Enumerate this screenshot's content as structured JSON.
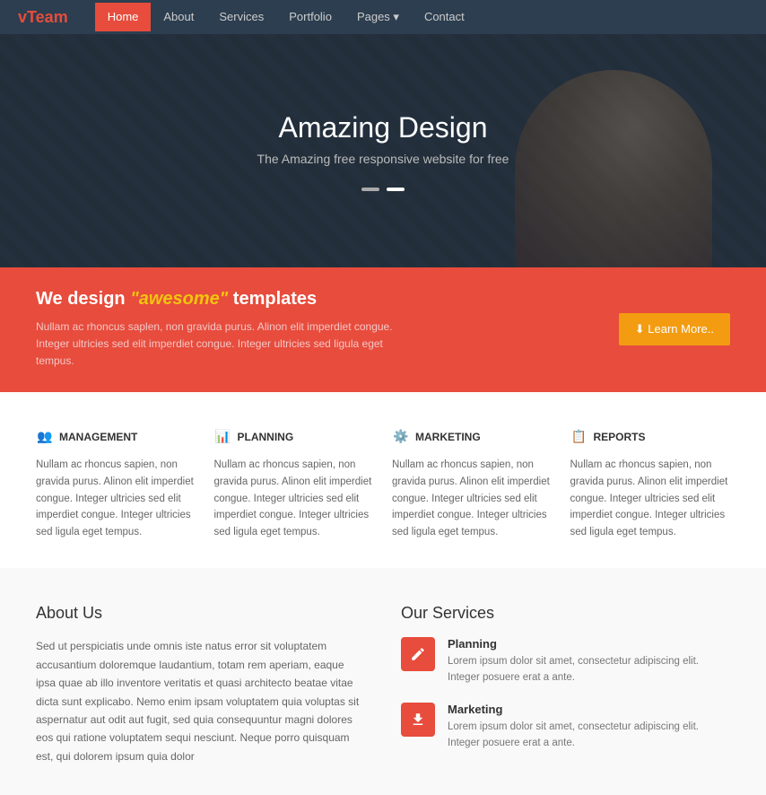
{
  "brand": {
    "text_v": "v",
    "text_team": "Team"
  },
  "nav": {
    "links": [
      {
        "label": "Home",
        "active": true
      },
      {
        "label": "About",
        "active": false
      },
      {
        "label": "Services",
        "active": false
      },
      {
        "label": "Portfolio",
        "active": false
      },
      {
        "label": "Pages ▾",
        "active": false
      },
      {
        "label": "Contact",
        "active": false
      }
    ]
  },
  "hero": {
    "title": "Amazing Design",
    "subtitle": "The Amazing free responsive website for free"
  },
  "banner": {
    "heading_start": "We design ",
    "heading_awesome": "\"awesome\"",
    "heading_end": " templates",
    "body": "Nullam ac rhoncus saplen, non gravida purus. Alinon elit imperdiet congue. Integer ultricies sed elit imperdiet congue. Integer ultricies sed ligula eget tempus.",
    "btn_label": "⬇ Learn More.."
  },
  "features": [
    {
      "icon": "👥",
      "title": "MANAGEMENT",
      "text": "Nullam ac rhoncus sapien, non gravida purus. Alinon elit imperdiet congue. Integer ultricies sed elit imperdiet congue. Integer ultricies sed ligula eget tempus."
    },
    {
      "icon": "📊",
      "title": "PLANNING",
      "text": "Nullam ac rhoncus sapien, non gravida purus. Alinon elit imperdiet congue. Integer ultricies sed elit imperdiet congue. Integer ultricies sed ligula eget tempus."
    },
    {
      "icon": "⚙️",
      "title": "MARKETING",
      "text": "Nullam ac rhoncus sapien, non gravida purus. Alinon elit imperdiet congue. Integer ultricies sed elit imperdiet congue. Integer ultricies sed ligula eget tempus."
    },
    {
      "icon": "📋",
      "title": "REPORTS",
      "text": "Nullam ac rhoncus sapien, non gravida purus. Alinon elit imperdiet congue. Integer ultricies sed elit imperdiet congue. Integer ultricies sed ligula eget tempus."
    }
  ],
  "about": {
    "heading": "About Us",
    "text": "Sed ut perspiciatis unde omnis iste natus error sit voluptatem accusantium doloremque laudantium, totam rem aperiam, eaque ipsa quae ab illo inventore veritatis et quasi architecto beatae vitae dicta sunt explicabo. Nemo enim ipsam voluptatem quia voluptas sit aspernatur aut odit aut fugit, sed quia consequuntur magni dolores eos qui ratione voluptatem sequi nesciunt. Neque porro quisquam est, qui dolorem ipsum quia dolor"
  },
  "services": {
    "heading": "Our Services",
    "items": [
      {
        "icon_type": "edit",
        "title": "Planning",
        "text": "Lorem ipsum dolor sit amet, consectetur adipiscing elit. Integer posuere erat a ante."
      },
      {
        "icon_type": "download",
        "title": "Marketing",
        "text": "Lorem ipsum dolor sit amet, consectetur adipiscing elit. Integer posuere erat a ante."
      }
    ]
  }
}
